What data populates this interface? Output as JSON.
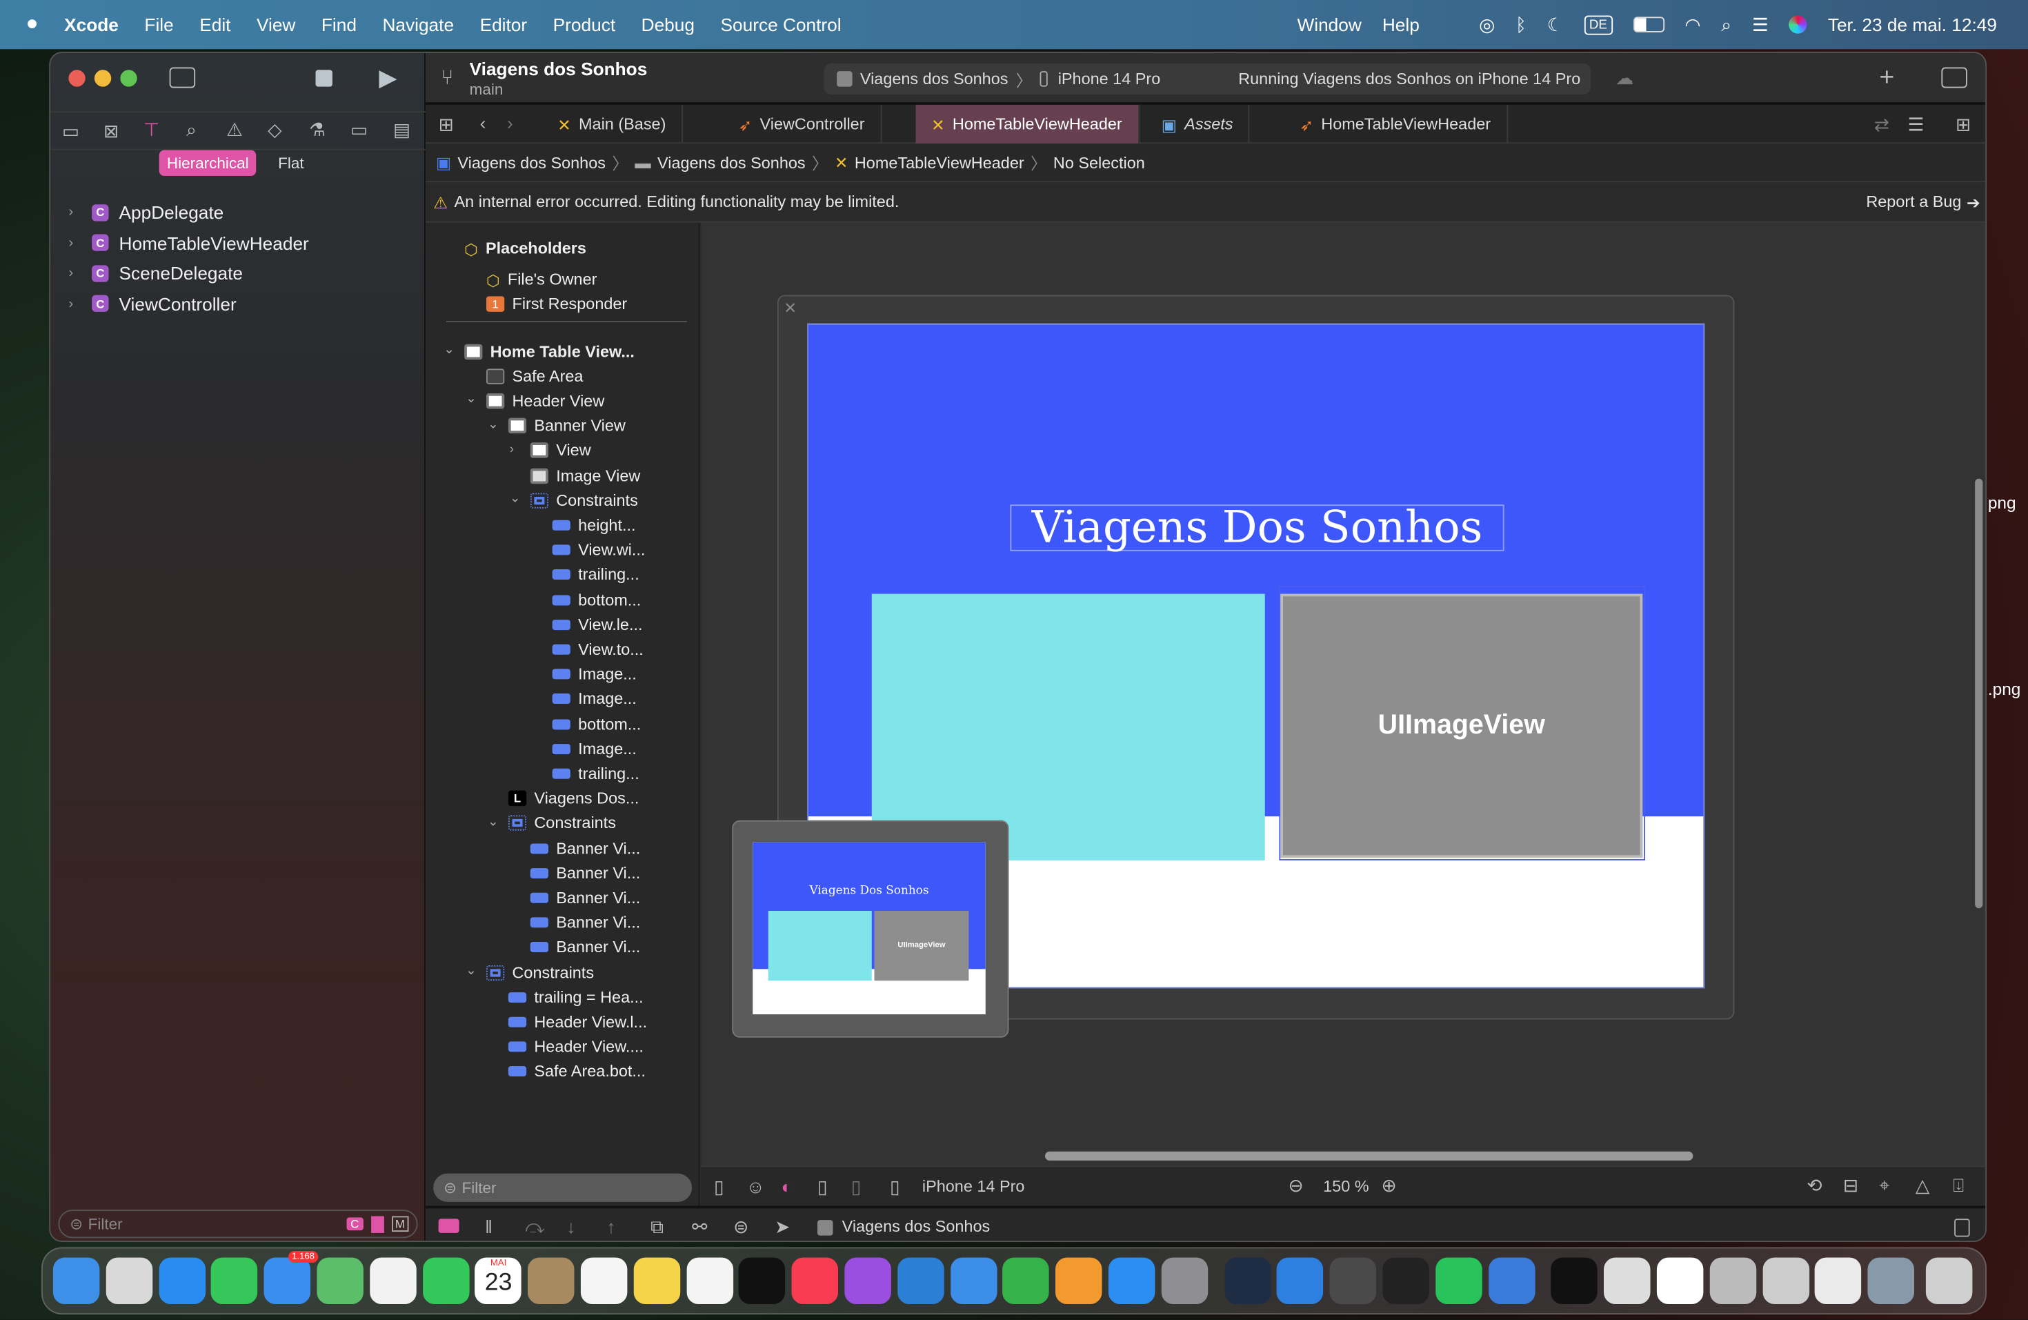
{
  "menubar": {
    "apple": "",
    "items": [
      "Xcode",
      "File",
      "Edit",
      "View",
      "Find",
      "Navigate",
      "Editor",
      "Product",
      "Debug",
      "Source Control"
    ],
    "right_items": [
      "Window",
      "Help"
    ],
    "input_source": "DE",
    "datetime": "Ter. 23 de mai.  12:49"
  },
  "desktop": {
    "labels": [
      "png",
      ".png"
    ]
  },
  "sidebar": {
    "mode_hierarchical": "Hierarchical",
    "mode_flat": "Flat",
    "files": [
      "AppDelegate",
      "HomeTableViewHeader",
      "SceneDelegate",
      "ViewController"
    ],
    "class_badge": "C",
    "filter_placeholder": "Filter"
  },
  "toolbar": {
    "project": "Viagens dos Sonhos",
    "branch": "main",
    "scheme": "Viagens dos Sonhos",
    "device": "iPhone 14 Pro",
    "status": "Running Viagens dos Sonhos on iPhone 14 Pro"
  },
  "tabs": [
    {
      "label": "Main (Base)",
      "icon": "xib-icon"
    },
    {
      "label": "ViewController",
      "icon": "swift-icon"
    },
    {
      "label": "HomeTableViewHeader",
      "icon": "xib-icon",
      "active": true
    },
    {
      "label": "Assets",
      "icon": "assets-icon"
    },
    {
      "label": "HomeTableViewHeader",
      "icon": "swift-icon"
    }
  ],
  "breadcrumb": [
    "Viagens dos Sonhos",
    "Viagens dos Sonhos",
    "HomeTableViewHeader",
    "No Selection"
  ],
  "warning": {
    "text": "An internal error occurred. Editing functionality may be limited.",
    "report": "Report a Bug"
  },
  "outline": {
    "placeholders": "Placeholders",
    "files_owner": "File's Owner",
    "first_responder": "First Responder",
    "first_responder_badge": "1",
    "items": [
      {
        "label": "Home Table View...",
        "level": 0,
        "icon": "view",
        "chev": "down",
        "bold": true
      },
      {
        "label": "Safe Area",
        "level": 1,
        "icon": "safe"
      },
      {
        "label": "Header View",
        "level": 1,
        "icon": "view",
        "chev": "down"
      },
      {
        "label": "Banner View",
        "level": 2,
        "icon": "view",
        "chev": "down"
      },
      {
        "label": "View",
        "level": 3,
        "icon": "view",
        "chev": "right"
      },
      {
        "label": "Image View",
        "level": 3,
        "icon": "image"
      },
      {
        "label": "Constraints",
        "level": 3,
        "icon": "constraints",
        "chev": "down"
      },
      {
        "label": "height...",
        "level": 4,
        "icon": "constraint"
      },
      {
        "label": "View.wi...",
        "level": 4,
        "icon": "constraint"
      },
      {
        "label": "trailing...",
        "level": 4,
        "icon": "constraint"
      },
      {
        "label": "bottom...",
        "level": 4,
        "icon": "constraint"
      },
      {
        "label": "View.le...",
        "level": 4,
        "icon": "constraint"
      },
      {
        "label": "View.to...",
        "level": 4,
        "icon": "constraint"
      },
      {
        "label": "Image...",
        "level": 4,
        "icon": "constraint"
      },
      {
        "label": "Image...",
        "level": 4,
        "icon": "constraint"
      },
      {
        "label": "bottom...",
        "level": 4,
        "icon": "constraint"
      },
      {
        "label": "Image...",
        "level": 4,
        "icon": "constraint"
      },
      {
        "label": "trailing...",
        "level": 4,
        "icon": "constraint"
      },
      {
        "label": "Viagens Dos...",
        "level": 2,
        "icon": "label"
      },
      {
        "label": "Constraints",
        "level": 2,
        "icon": "constraints",
        "chev": "down"
      },
      {
        "label": "Banner Vi...",
        "level": 3,
        "icon": "constraint"
      },
      {
        "label": "Banner Vi...",
        "level": 3,
        "icon": "constraint"
      },
      {
        "label": "Banner Vi...",
        "level": 3,
        "icon": "constraint"
      },
      {
        "label": "Banner Vi...",
        "level": 3,
        "icon": "constraint"
      },
      {
        "label": "Banner Vi...",
        "level": 3,
        "icon": "constraint"
      },
      {
        "label": "Constraints",
        "level": 1,
        "icon": "constraints",
        "chev": "down"
      },
      {
        "label": "trailing = Hea...",
        "level": 2,
        "icon": "constraint"
      },
      {
        "label": "Header View.l...",
        "level": 2,
        "icon": "constraint"
      },
      {
        "label": "Header View....",
        "level": 2,
        "icon": "constraint"
      },
      {
        "label": "Safe Area.bot...",
        "level": 2,
        "icon": "constraint"
      }
    ],
    "filter_placeholder": "Filter"
  },
  "canvas": {
    "title_label": "Viagens Dos Sonhos",
    "image_placeholder": "UIImageView",
    "colors": {
      "banner": "#3d57fa",
      "cyan": "#80e5ea",
      "image": "#8e8e8e"
    }
  },
  "canvas_bar": {
    "device": "iPhone 14 Pro",
    "zoom": "150 %"
  },
  "debug_bar": {
    "target": "Viagens dos Sonhos"
  },
  "dock": {
    "mail_badge": "1.168",
    "calendar_month": "MAI",
    "calendar_day": "23",
    "icons": [
      [
        "finder-icon",
        "#3d8fe8"
      ],
      [
        "launchpad-icon",
        "#d9d9d9"
      ],
      [
        "safari-icon",
        "#2a8cf0"
      ],
      [
        "messages-icon",
        "#35c759"
      ],
      [
        "mail-icon",
        "#3a8ef0"
      ],
      [
        "maps-icon",
        "#5bbf6a"
      ],
      [
        "photos-icon",
        "#f2f2f2"
      ],
      [
        "facetime-icon",
        "#34c759"
      ],
      [
        "calendar-icon",
        "#ffffff"
      ],
      [
        "contacts-icon",
        "#a88a60"
      ],
      [
        "reminders-icon",
        "#f5f5f5"
      ],
      [
        "notes-icon",
        "#f6d44a"
      ],
      [
        "freeform-icon",
        "#f4f4f4"
      ],
      [
        "appletv-icon",
        "#111111"
      ],
      [
        "music-icon",
        "#fa3c52"
      ],
      [
        "podcasts-icon",
        "#9b4fe0"
      ],
      [
        "vscode-icon",
        "#2b7fd4"
      ],
      [
        "keynote-icon",
        "#3c8ee8"
      ],
      [
        "numbers-icon",
        "#36b24a"
      ],
      [
        "pages-icon",
        "#f29a2e"
      ],
      [
        "appstore-icon",
        "#2d8ef2"
      ],
      [
        "settings-icon",
        "#8e8e93"
      ],
      [
        "quicktime-icon",
        "#1f2d44"
      ],
      [
        "xcode-icon",
        "#2d7fe0"
      ],
      [
        "instruments-icon",
        "#4a4a4a"
      ],
      [
        "terminal-icon",
        "#222222"
      ],
      [
        "whatsapp-icon",
        "#29c35b"
      ],
      [
        "simulator-icon",
        "#3a7ad8"
      ],
      [
        "window-thumb-icon",
        "#111111"
      ],
      [
        "window-thumb-icon",
        "#dddddd"
      ],
      [
        "window-thumb-icon",
        "#ffffff"
      ],
      [
        "window-thumb-icon",
        "#bbbbbb"
      ],
      [
        "window-thumb-icon",
        "#cccccc"
      ],
      [
        "window-thumb-icon",
        "#eaeaea"
      ],
      [
        "window-thumb-icon",
        "#8899aa"
      ],
      [
        "trash-icon",
        "#cfcfcf"
      ]
    ]
  }
}
